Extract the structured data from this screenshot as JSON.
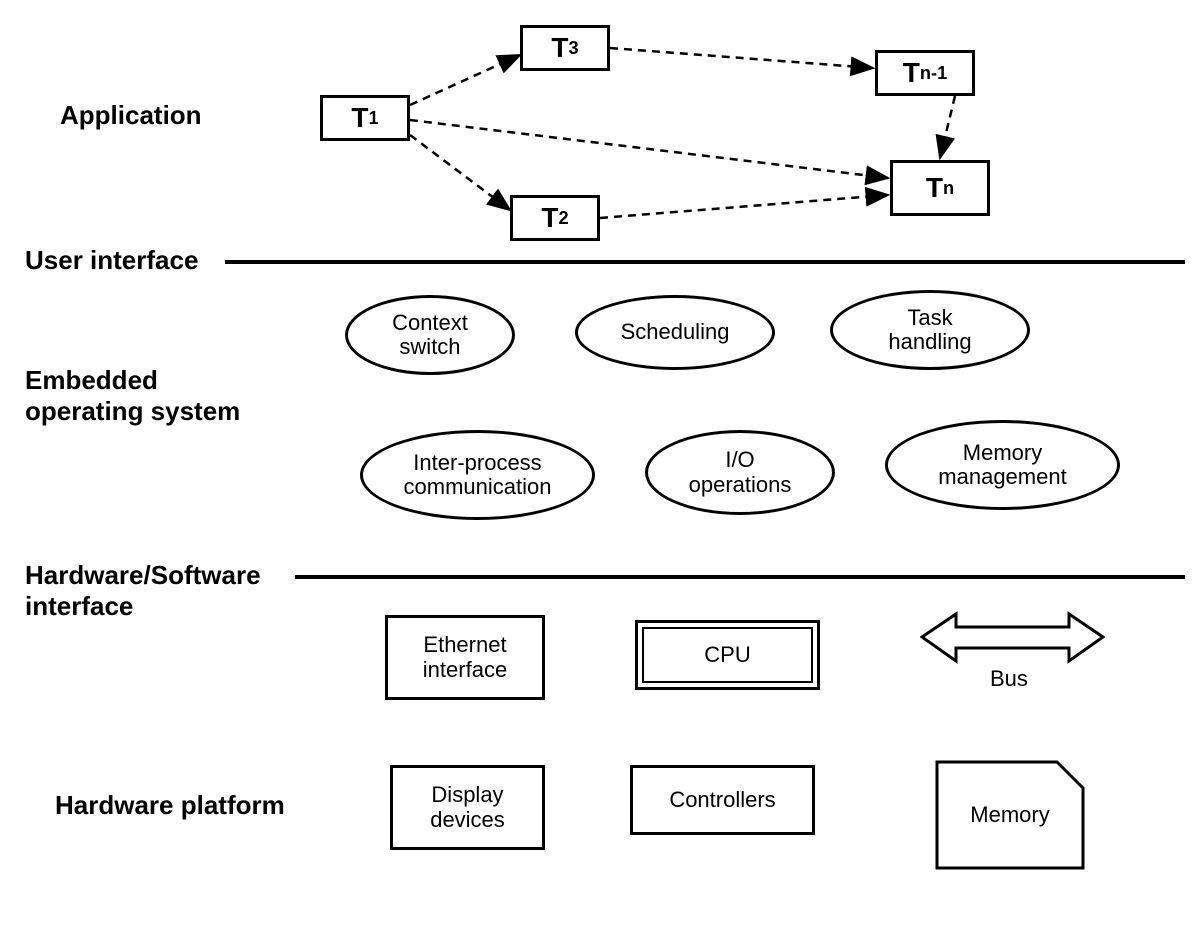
{
  "layers": {
    "application": "Application",
    "user_interface": "User interface",
    "embedded_os": "Embedded\noperating system",
    "hw_sw_interface": "Hardware/Software\ninterface",
    "hw_platform": "Hardware platform"
  },
  "tasks": {
    "t1": "T",
    "t1_sub": "1",
    "t2": "T",
    "t2_sub": "2",
    "t3": "T",
    "t3_sub": "3",
    "tn1": "T",
    "tn1_sub": "n-1",
    "tn": "T",
    "tn_sub": "n"
  },
  "os_functions": {
    "context_switch": "Context\nswitch",
    "scheduling": "Scheduling",
    "task_handling": "Task\nhandling",
    "ipc": "Inter-process\ncommunication",
    "io_ops": "I/O\noperations",
    "mem_mgmt": "Memory\nmanagement"
  },
  "hardware": {
    "ethernet": "Ethernet\ninterface",
    "cpu": "CPU",
    "bus": "Bus",
    "display": "Display\ndevices",
    "controllers": "Controllers",
    "memory": "Memory"
  }
}
